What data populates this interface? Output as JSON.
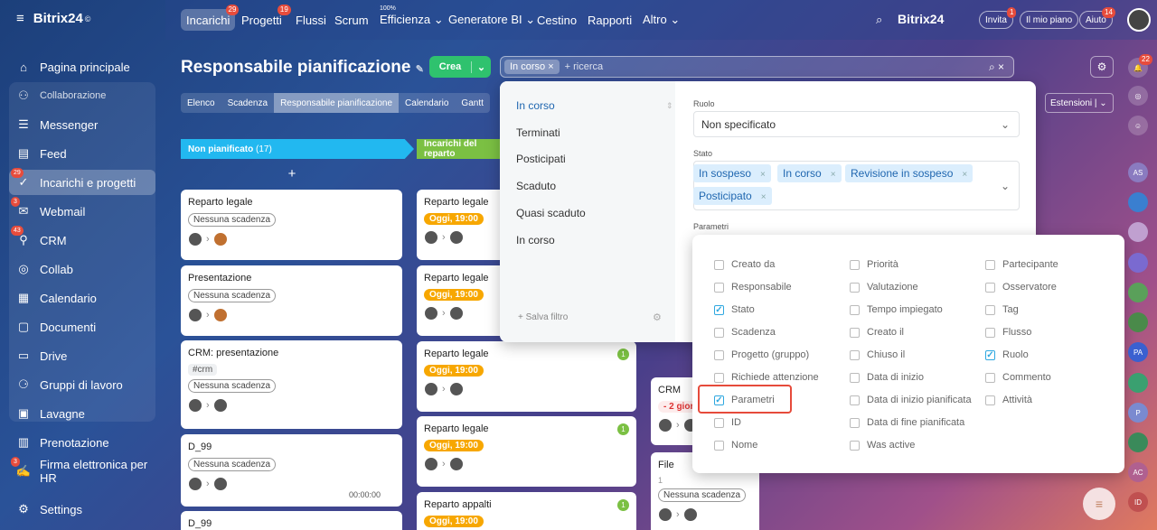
{
  "sidebar": {
    "logo": "Bitrix24",
    "logo_mark": "©",
    "items": [
      {
        "label": "Pagina principale",
        "icon": "home-icon"
      },
      {
        "label": "Collaborazione",
        "icon": "collab-group-icon"
      },
      {
        "label": "Messenger",
        "icon": "chat-icon"
      },
      {
        "label": "Feed",
        "icon": "feed-icon"
      },
      {
        "label": "Incarichi e progetti",
        "icon": "tasks-icon",
        "badge": "29"
      },
      {
        "label": "Webmail",
        "icon": "mail-icon",
        "badge": "3"
      },
      {
        "label": "CRM",
        "icon": "crm-icon",
        "badge": "43"
      },
      {
        "label": "Collab",
        "icon": "collab-icon"
      },
      {
        "label": "Calendario",
        "icon": "calendar-icon"
      },
      {
        "label": "Documenti",
        "icon": "documents-icon"
      },
      {
        "label": "Drive",
        "icon": "drive-icon"
      },
      {
        "label": "Gruppi di lavoro",
        "icon": "groups-icon"
      },
      {
        "label": "Lavagne",
        "icon": "boards-icon"
      },
      {
        "label": "Prenotazione",
        "icon": "booking-icon"
      },
      {
        "label": "Firma elettronica per HR",
        "icon": "signature-icon",
        "badge": "3"
      },
      {
        "label": "Settings",
        "icon": "gear-icon"
      }
    ]
  },
  "topbar": {
    "tabs": [
      {
        "label": "Incarichi",
        "badge": "29"
      },
      {
        "label": "Progetti",
        "badge": "19"
      },
      {
        "label": "Flussi"
      },
      {
        "label": "Scrum"
      },
      {
        "label": "Efficienza ⌄",
        "sup": "100%"
      },
      {
        "label": "Generatore BI ⌄"
      },
      {
        "label": "Cestino"
      },
      {
        "label": "Rapporti"
      },
      {
        "label": "Altro ⌄"
      }
    ],
    "brand": "Bitrix24",
    "invite": "Invita",
    "invite_badge": "1",
    "plan": "Il mio piano",
    "help": "Aiuto",
    "help_badge": "14"
  },
  "header": {
    "title": "Responsabile pianificazione",
    "create": "Crea",
    "chip": "In corso",
    "search_placeholder": "+ ricerca",
    "extensions": "Estensioni"
  },
  "view_tabs": [
    "Elenco",
    "Scadenza",
    "Responsabile pianificazione",
    "Calendario",
    "Gantt"
  ],
  "columns": [
    {
      "title": "Non pianificato",
      "count": "(17)",
      "color": "#22b8f0"
    },
    {
      "title": "Incarichi del reparto",
      "color": "#7bc043"
    }
  ],
  "col1_cards": [
    {
      "title": "Reparto legale",
      "badge": "Nessuna scadenza"
    },
    {
      "title": "Presentazione",
      "badge": "Nessuna scadenza"
    },
    {
      "title": "CRM: presentazione",
      "tag": "#crm",
      "badge": "Nessuna scadenza"
    },
    {
      "title": "D_99",
      "badge": "Nessuna scadenza",
      "time": "00:00:00"
    },
    {
      "title": "D_99"
    }
  ],
  "col2_cards": [
    {
      "title": "Reparto legale",
      "badge": "Oggi, 19:00"
    },
    {
      "title": "Reparto legale",
      "badge": "Oggi, 19:00"
    },
    {
      "title": "Reparto legale",
      "badge": "Oggi, 19:00",
      "count": "1"
    },
    {
      "title": "Reparto legale",
      "badge": "Oggi, 19:00",
      "count": "1"
    },
    {
      "title": "Reparto appalti",
      "badge": "Oggi, 19:00",
      "count": "1"
    }
  ],
  "col3_cards": [
    {
      "title": "CRM",
      "badge": "- 2 gior"
    },
    {
      "title": "File",
      "sub": "1",
      "badge": "Nessuna scadenza"
    }
  ],
  "filter": {
    "presets": [
      "In corso",
      "Terminati",
      "Posticipati",
      "Scaduto",
      "Quasi scaduto",
      "In corso"
    ],
    "save": "+ Salva filtro",
    "role_label": "Ruolo",
    "role_value": "Non specificato",
    "status_label": "Stato",
    "status_tags": [
      "In sospeso",
      "In corso",
      "Revisione in sospeso",
      "Posticipato"
    ],
    "params_label": "Parametri"
  },
  "fields": {
    "col1": [
      {
        "label": "Creato da",
        "checked": false
      },
      {
        "label": "Responsabile",
        "checked": false
      },
      {
        "label": "Stato",
        "checked": true
      },
      {
        "label": "Scadenza",
        "checked": false
      },
      {
        "label": "Progetto (gruppo)",
        "checked": false
      },
      {
        "label": "Richiede attenzione",
        "checked": false
      },
      {
        "label": "Parametri",
        "checked": true
      },
      {
        "label": "ID",
        "checked": false
      },
      {
        "label": "Nome",
        "checked": false
      }
    ],
    "col2": [
      {
        "label": "Priorità",
        "checked": false
      },
      {
        "label": "Valutazione",
        "checked": false
      },
      {
        "label": "Tempo impiegato",
        "checked": false
      },
      {
        "label": "Creato il",
        "checked": false
      },
      {
        "label": "Chiuso il",
        "checked": false
      },
      {
        "label": "Data di inizio",
        "checked": false
      },
      {
        "label": "Data di inizio pianificata",
        "checked": false
      },
      {
        "label": "Data di fine pianificata",
        "checked": false
      },
      {
        "label": "Was active",
        "checked": false
      }
    ],
    "col3": [
      {
        "label": "Partecipante",
        "checked": false
      },
      {
        "label": "Osservatore",
        "checked": false
      },
      {
        "label": "Tag",
        "checked": false
      },
      {
        "label": "Flusso",
        "checked": false
      },
      {
        "label": "Ruolo",
        "checked": true
      },
      {
        "label": "Commento",
        "checked": false
      },
      {
        "label": "Attività",
        "checked": false
      }
    ]
  },
  "rail": {
    "badge": "22",
    "items": [
      "AS",
      "PA",
      "P",
      "AC",
      "ID"
    ]
  }
}
